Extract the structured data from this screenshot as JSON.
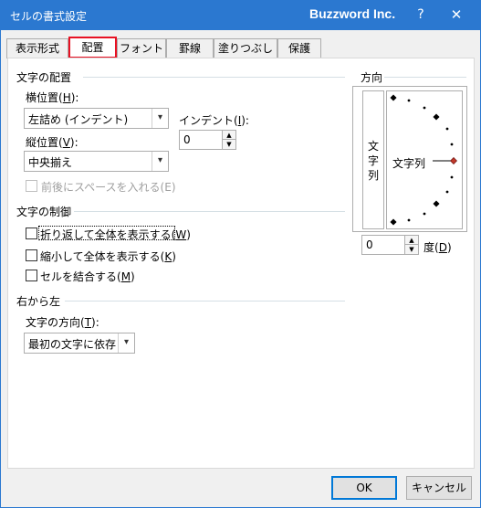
{
  "window": {
    "title": "セルの書式設定",
    "brand": "Buzzword Inc.",
    "help": "?",
    "close": "✕"
  },
  "tabs": [
    {
      "label": "表示形式",
      "active": false
    },
    {
      "label": "配置",
      "active": true
    },
    {
      "label": "フォント",
      "active": false
    },
    {
      "label": "罫線",
      "active": false
    },
    {
      "label": "塗りつぶし",
      "active": false
    },
    {
      "label": "保護",
      "active": false
    }
  ],
  "alignment": {
    "section_title": "文字の配置",
    "horizontal": {
      "label_pre": "横位置(",
      "hotkey": "H",
      "label_post": "):",
      "value": "左詰め (インデント)"
    },
    "vertical": {
      "label_pre": "縦位置(",
      "hotkey": "V",
      "label_post": "):",
      "value": "中央揃え"
    },
    "indent": {
      "label_pre": "インデント(",
      "hotkey": "I",
      "label_post": "):",
      "value": "0"
    },
    "justify_distributed": {
      "label": "前後にスペースを入れる(E)",
      "checked": false,
      "enabled": false
    }
  },
  "text_control": {
    "section_title": "文字の制御",
    "wrap": {
      "label_pre": "折り返して全体を表示する(",
      "hotkey": "W",
      "label_post": ")",
      "checked": false
    },
    "shrink": {
      "label_pre": "縮小して全体を表示する(",
      "hotkey": "K",
      "label_post": ")",
      "checked": false
    },
    "merge": {
      "label_pre": "セルを結合する(",
      "hotkey": "M",
      "label_post": ")",
      "checked": false
    }
  },
  "rtl": {
    "section_title": "右から左",
    "direction": {
      "label_pre": "文字の方向(",
      "hotkey": "T",
      "label_post": "):",
      "value": "最初の文字に依存"
    }
  },
  "orientation": {
    "section_title": "方向",
    "vertical_text": "文字列",
    "dial_text": "文字列",
    "degrees_value": "0",
    "degrees_label_pre": "度(",
    "degrees_hotkey": "D",
    "degrees_label_post": ")",
    "accent_color": "#c0392b"
  },
  "buttons": {
    "ok": "OK",
    "cancel": "キャンセル"
  },
  "icons": {
    "dropdown": "▾",
    "spin_up": "▲",
    "spin_down": "▼"
  }
}
